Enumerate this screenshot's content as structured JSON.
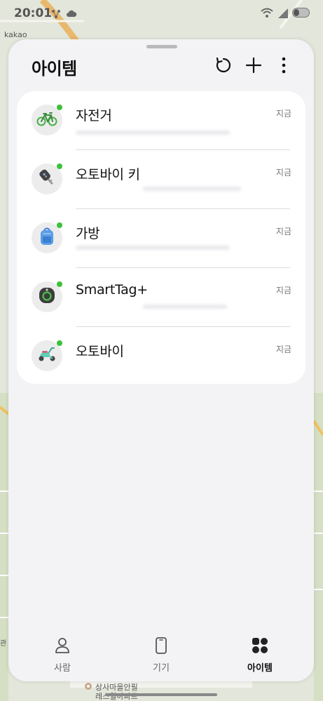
{
  "status_bar": {
    "time": "20:01",
    "left_icons": [
      "network-icon",
      "cloud-icon"
    ],
    "right_icons": [
      "wifi-6e-icon",
      "signal-icon",
      "battery-icon"
    ]
  },
  "map": {
    "corner_label": "kakao",
    "bottom_labels": [
      "상사마을안필",
      "레스힐아파트"
    ],
    "edge_label": "관"
  },
  "sheet": {
    "title": "아이템",
    "actions": [
      {
        "name": "refresh",
        "icon": "refresh-icon"
      },
      {
        "name": "add",
        "icon": "plus-icon"
      },
      {
        "name": "more",
        "icon": "more-vertical-icon"
      }
    ]
  },
  "items": [
    {
      "name": "자전거",
      "time": "지금",
      "icon": "bicycle-icon",
      "online": true
    },
    {
      "name": "오토바이 키",
      "time": "지금",
      "icon": "motorcycle-key-icon",
      "online": true
    },
    {
      "name": "가방",
      "time": "지금",
      "icon": "backpack-icon",
      "online": true
    },
    {
      "name": "SmartTag+",
      "time": "지금",
      "icon": "smarttag-icon",
      "online": true
    },
    {
      "name": "오토바이",
      "time": "지금",
      "icon": "scooter-icon",
      "online": true
    }
  ],
  "nav": {
    "items": [
      {
        "label": "사람",
        "icon": "person-icon",
        "active": false
      },
      {
        "label": "기기",
        "icon": "phone-icon",
        "active": false
      },
      {
        "label": "아이템",
        "icon": "items-grid-icon",
        "active": true
      }
    ]
  },
  "colors": {
    "online_dot": "#3cc13b",
    "sheet_bg": "#f3f2f5",
    "card_bg": "#ffffff"
  }
}
